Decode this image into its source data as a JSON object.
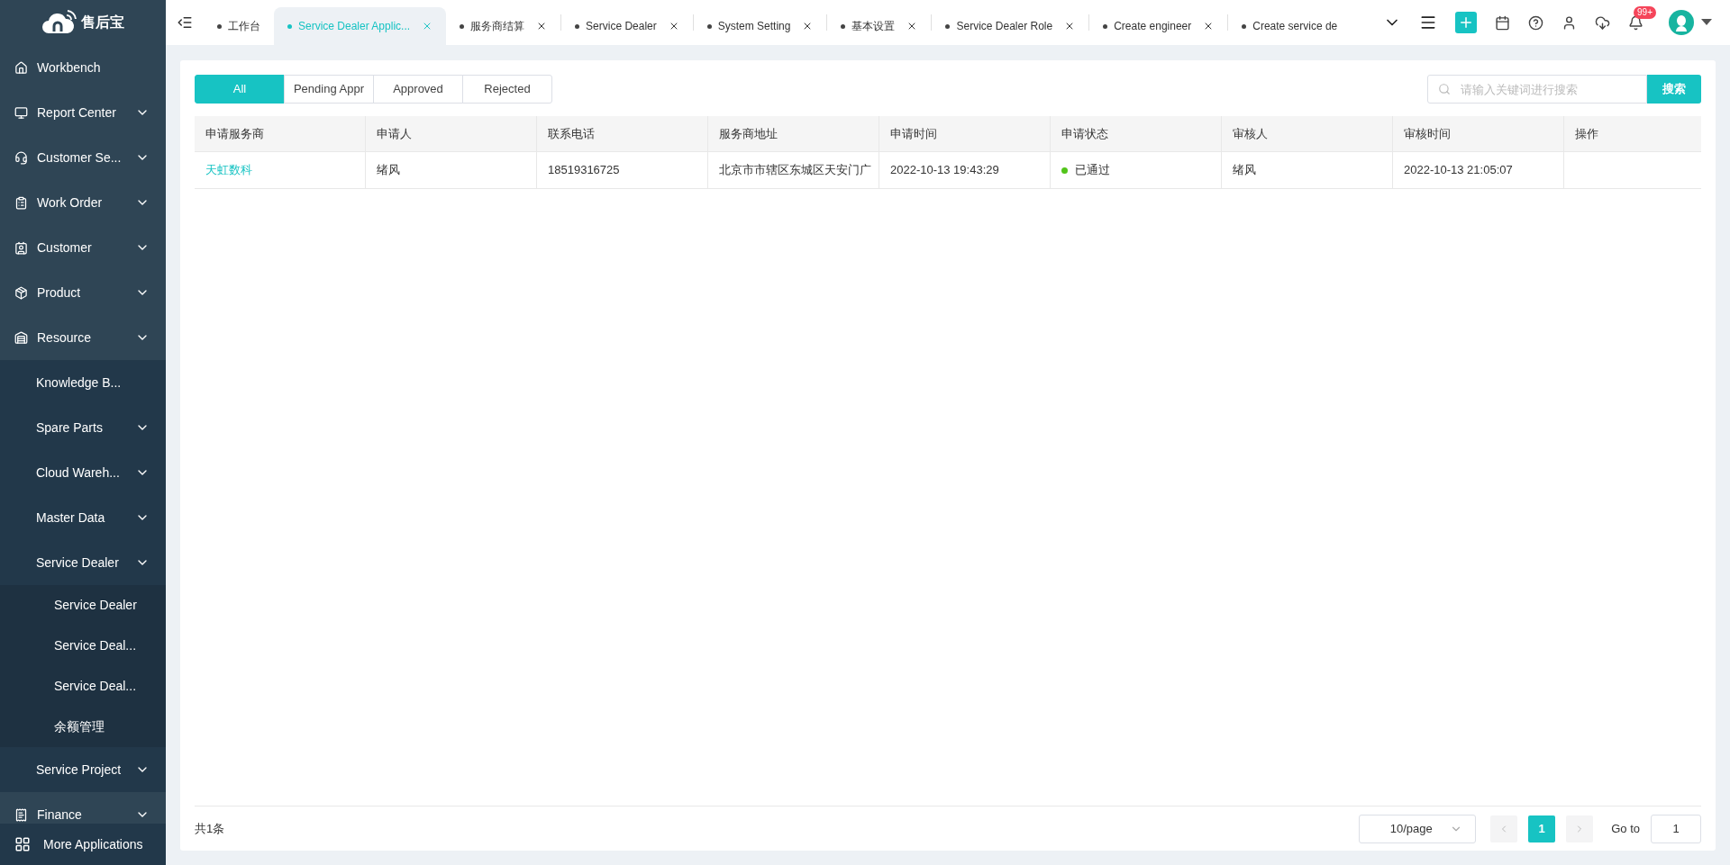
{
  "app": {
    "logo_text": "售后宝"
  },
  "sidebar": {
    "items": [
      {
        "label": "Workbench",
        "expandable": false
      },
      {
        "label": "Report Center",
        "expandable": true
      },
      {
        "label": "Customer Se...",
        "expandable": true
      },
      {
        "label": "Work Order",
        "expandable": true
      },
      {
        "label": "Customer",
        "expandable": true
      },
      {
        "label": "Product",
        "expandable": true
      },
      {
        "label": "Resource",
        "expandable": true,
        "children": [
          {
            "label": "Knowledge B...",
            "expandable": false
          },
          {
            "label": "Spare Parts",
            "expandable": true
          },
          {
            "label": "Cloud Wareh...",
            "expandable": true
          },
          {
            "label": "Master Data",
            "expandable": true
          },
          {
            "label": "Service Dealer",
            "expandable": true,
            "children": [
              {
                "label": "Service Dealer",
                "expandable": false
              },
              {
                "label": "Service Deal...",
                "expandable": false
              },
              {
                "label": "Service Deal...",
                "expandable": false
              },
              {
                "label": "余额管理",
                "expandable": false
              }
            ]
          },
          {
            "label": "Service Project",
            "expandable": true
          }
        ]
      },
      {
        "label": "Finance",
        "expandable": true
      }
    ],
    "more": "More Applications"
  },
  "tabs": [
    {
      "label": "工作台",
      "selected": false,
      "closable": false
    },
    {
      "label": "Service Dealer Applic...",
      "selected": true,
      "closable": true
    },
    {
      "label": "服务商结算",
      "selected": false,
      "closable": true
    },
    {
      "label": "Service Dealer",
      "selected": false,
      "closable": true
    },
    {
      "label": "System Setting",
      "selected": false,
      "closable": true
    },
    {
      "label": "基本设置",
      "selected": false,
      "closable": true
    },
    {
      "label": "Service Dealer Role",
      "selected": false,
      "closable": true
    },
    {
      "label": "Create engineer",
      "selected": false,
      "closable": true
    },
    {
      "label": "Create service de",
      "selected": false,
      "closable": false
    }
  ],
  "header": {
    "notification_badge": "99+"
  },
  "filters": [
    {
      "label": "All",
      "selected": true
    },
    {
      "label": "Pending Appr",
      "selected": false
    },
    {
      "label": "Approved",
      "selected": false
    },
    {
      "label": "Rejected",
      "selected": false
    }
  ],
  "search": {
    "placeholder": "请输入关键词进行搜索",
    "button": "搜索"
  },
  "table": {
    "columns": [
      "申请服务商",
      "申请人",
      "联系电话",
      "服务商地址",
      "申请时间",
      "申请状态",
      "审核人",
      "审核时间",
      "操作"
    ],
    "rows": [
      {
        "dealer": "天虹数科",
        "applicant": "绪风",
        "phone": "18519316725",
        "address": "北京市市辖区东城区天安门广",
        "applied_at": "2022-10-13 19:43:29",
        "status": {
          "label": "已通过",
          "color": "#52c41a"
        },
        "reviewer": "绪风",
        "reviewed_at": "2022-10-13 21:05:07"
      }
    ]
  },
  "pagination": {
    "total": "共1条",
    "page_size": "10/page",
    "pages": [
      {
        "label": "1",
        "selected": true
      }
    ],
    "goto_label": "Go to",
    "goto_value": "1"
  }
}
